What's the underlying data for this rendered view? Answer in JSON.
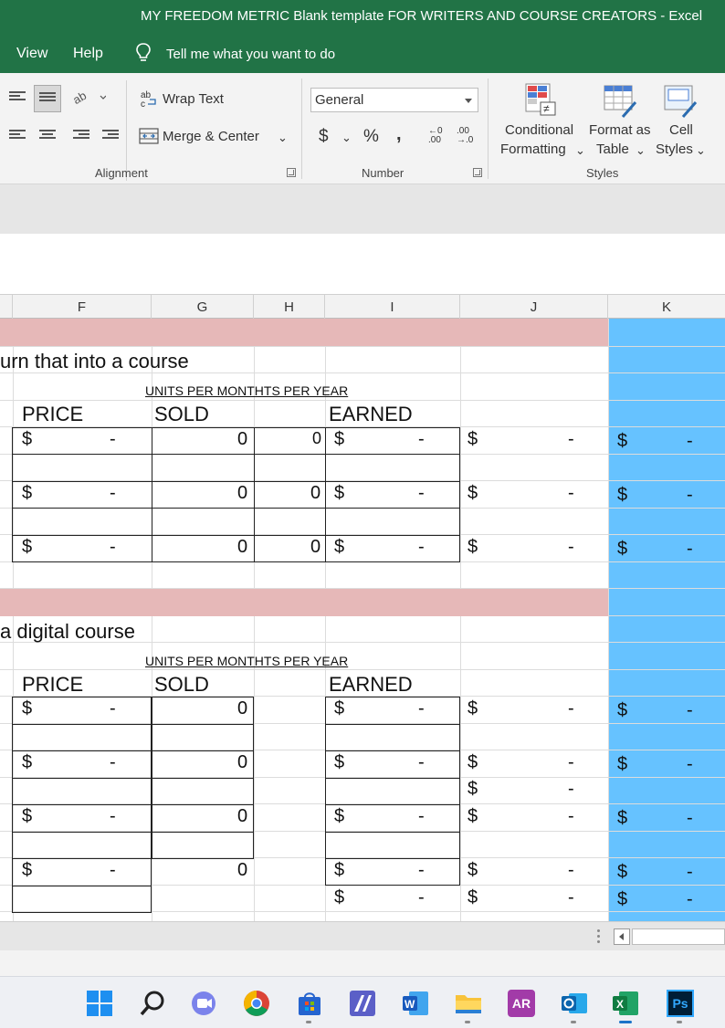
{
  "window": {
    "title": "MY FREEDOM METRIC Blank template FOR WRITERS AND COURSE CREATORS  -  Excel"
  },
  "menu": {
    "view": "View",
    "help": "Help",
    "tell_me": "Tell me what you want to do"
  },
  "ribbon": {
    "alignment": {
      "wrap_text": "Wrap Text",
      "merge_center": "Merge & Center",
      "group_label": "Alignment"
    },
    "number": {
      "format_value": "General",
      "currency": "$",
      "percent": "%",
      "comma": ",",
      "increase_decimal_top": "←0",
      "increase_decimal_bottom": ".00",
      "decrease_decimal_top": ".00",
      "decrease_decimal_bottom": "→.0",
      "group_label": "Number"
    },
    "styles": {
      "conditional_1": "Conditional",
      "conditional_2": "Formatting",
      "format_as_1": "Format as",
      "format_as_2": "Table",
      "cell_styles_1": "Cell",
      "cell_styles_2": "Styles",
      "group_label": "Styles"
    }
  },
  "columns": [
    "F",
    "G",
    "H",
    "I",
    "J",
    "K"
  ],
  "colors": {
    "title_green": "#217346",
    "pink_band": "#e6b8b8",
    "blue_column": "#66c2ff"
  },
  "sheet": {
    "section1_title": "urn that into a course",
    "section2_title": "a digital course",
    "units_header": "UNITS PER MONTHTS PER YEAR",
    "price_header": "PRICE",
    "sold_header": "SOLD",
    "earned_header": "EARNED",
    "dollar": "$",
    "dash": "-",
    "zero": "0"
  },
  "taskbar": {
    "icons": [
      "windows-start-icon",
      "search-icon",
      "teams-icon",
      "chrome-icon",
      "store-icon",
      "editor-icon",
      "word-icon",
      "file-explorer-icon",
      "ar-app-icon",
      "outlook-icon",
      "excel-icon",
      "photoshop-icon"
    ],
    "ar_label": "AR",
    "ps_label": "Ps"
  }
}
